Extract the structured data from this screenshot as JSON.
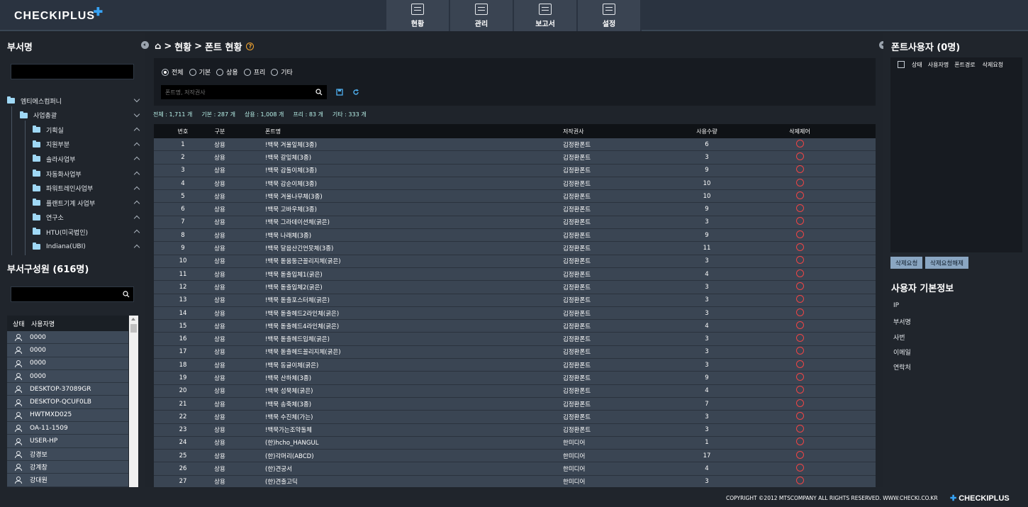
{
  "app": {
    "logo": "CHECKIPLUS",
    "logo_plus": "✚"
  },
  "nav": [
    {
      "label": "현황",
      "icon": "monitor-icon"
    },
    {
      "label": "관리",
      "icon": "inbox-icon"
    },
    {
      "label": "보고서",
      "icon": "clipboard-icon"
    },
    {
      "label": "설정",
      "icon": "settings-icon"
    }
  ],
  "left": {
    "dept_title": "부서명",
    "dept_search": {
      "value": "",
      "placeholder": ""
    },
    "tree": [
      {
        "label": "엠티에스컴퍼니",
        "level": 0,
        "chev": "down"
      },
      {
        "label": "사업총괄",
        "level": 1,
        "chev": "down"
      },
      {
        "label": "기획실",
        "level": 2,
        "chev": "up"
      },
      {
        "label": "지원부분",
        "level": 2,
        "chev": "up"
      },
      {
        "label": "솔라사업부",
        "level": 2,
        "chev": "up"
      },
      {
        "label": "자동화사업부",
        "level": 2,
        "chev": "up"
      },
      {
        "label": "파워트레인사업부",
        "level": 2,
        "chev": "up"
      },
      {
        "label": "플랜트기계 사업부",
        "level": 2,
        "chev": "up"
      },
      {
        "label": "연구소",
        "level": 2,
        "chev": "up"
      },
      {
        "label": "HTU(미국법인)",
        "level": 2,
        "chev": "up"
      },
      {
        "label": "Indiana(UBI)",
        "level": 2,
        "chev": "up"
      }
    ],
    "members_title": "부서구성원 (616명)",
    "member_search": {
      "value": "",
      "placeholder": ""
    },
    "member_headers": {
      "status": "상태",
      "name": "사용자명"
    },
    "members": [
      "0000",
      "0000",
      "0000",
      "0000",
      "DESKTOP-37089GR",
      "DESKTOP-QCUF0LB",
      "HWTMXD025",
      "OA-11-1509",
      "USER-HP",
      "강경보",
      "강계창",
      "강대원"
    ]
  },
  "center": {
    "breadcrumb": {
      "home": "⌂",
      "sep": ">",
      "level1": "현황",
      "level2": "폰트 현황",
      "help": "?"
    },
    "filters": [
      "전체",
      "기본",
      "상용",
      "프리",
      "기타"
    ],
    "selected_filter": "전체",
    "search": {
      "value": "",
      "placeholder": "폰트명, 저작권사"
    },
    "stats": [
      "전체 : 1,711 개",
      "기본 : 287 개",
      "상용 : 1,008 개",
      "프리 : 83 개",
      "기타 : 333 개"
    ],
    "columns": [
      "번호",
      "구분",
      "폰트명",
      "저작권사",
      "사용수량",
      "삭제제어"
    ],
    "rows": [
      [
        "1",
        "상용",
        "!백묵 겨울잎체(3종)",
        "김정환폰트",
        "6"
      ],
      [
        "2",
        "상용",
        "!백묵 갈잎체(3종)",
        "김정환폰트",
        "3"
      ],
      [
        "3",
        "상용",
        "!백묵 감돌이체(3종)",
        "김정환폰트",
        "9"
      ],
      [
        "4",
        "상용",
        "!백묵 감순이체(3종)",
        "김정환폰트",
        "10"
      ],
      [
        "5",
        "상용",
        "!백묵 겨울나무체(3종)",
        "김정환폰트",
        "10"
      ],
      [
        "6",
        "상용",
        "!백묵 고바우체(3종)",
        "김정환폰트",
        "9"
      ],
      [
        "7",
        "상용",
        "!백묵 그라데이션체(굵은)",
        "김정환폰트",
        "3"
      ],
      [
        "8",
        "상용",
        "!백묵 나래체(3종)",
        "김정환폰트",
        "9"
      ],
      [
        "9",
        "상용",
        "!백묵 달음산긴언못체(3종)",
        "김정환폰트",
        "11"
      ],
      [
        "10",
        "상용",
        "!백묵 돋움둥근꼴리지체(굵은)",
        "김정환폰트",
        "3"
      ],
      [
        "11",
        "상용",
        "!백묵 돋출입체1(굵은)",
        "김정환폰트",
        "4"
      ],
      [
        "12",
        "상용",
        "!백묵 돋출입체2(굵은)",
        "김정환폰트",
        "3"
      ],
      [
        "13",
        "상용",
        "!백묵 돋출포스터체(굵은)",
        "김정환폰트",
        "3"
      ],
      [
        "14",
        "상용",
        "!백묵 돋출헤드2라인체(굵은)",
        "김정환폰트",
        "3"
      ],
      [
        "15",
        "상용",
        "!백묵 돋출헤드4라인체(굵은)",
        "김정환폰트",
        "4"
      ],
      [
        "16",
        "상용",
        "!백묵 돋출헤드입체(굵은)",
        "김정환폰트",
        "3"
      ],
      [
        "17",
        "상용",
        "!백묵 돋출헤드꼴리지체(굵은)",
        "김정환폰트",
        "3"
      ],
      [
        "18",
        "상용",
        "!백묵 동글이체(굵은)",
        "김정환폰트",
        "3"
      ],
      [
        "19",
        "상용",
        "!백묵 산하체(3종)",
        "김정환폰트",
        "9"
      ],
      [
        "20",
        "상용",
        "!백묵 섬묵체(굵은)",
        "김정환폰트",
        "4"
      ],
      [
        "21",
        "상용",
        "!백묵 송죽체(3종)",
        "김정환폰트",
        "7"
      ],
      [
        "22",
        "상용",
        "!백묵 수진체(가는)",
        "김정환폰트",
        "3"
      ],
      [
        "23",
        "상용",
        "!백묵가는조약돌체",
        "김정환폰트",
        "3"
      ],
      [
        "24",
        "상용",
        "(한)hcho_HANGUL",
        "한미디어",
        "1"
      ],
      [
        "25",
        "상용",
        "(한)각머리(ABCD)",
        "한미디어",
        "17"
      ],
      [
        "26",
        "상용",
        "(한)견궁서",
        "한미디어",
        "4"
      ],
      [
        "27",
        "상용",
        "(한)견출고딕",
        "한미디어",
        "3"
      ]
    ]
  },
  "right": {
    "title": "폰트사용자 (0명)",
    "columns": [
      "상태",
      "사용자명",
      "폰트경로",
      "삭제요청"
    ],
    "btn_request": "삭제요청",
    "btn_cancel": "삭제요청해제",
    "info_title": "사용자 기본정보",
    "info_items": [
      "IP",
      "부서명",
      "사번",
      "이메일",
      "연락처"
    ]
  },
  "footer": {
    "copyright": "COPYRIGHT ©2012 MTSCOMPANY ALL RIGHTS RESERVED.   WWW.CHECKI.CO.KR",
    "logo": "CHECKIPLUS"
  }
}
